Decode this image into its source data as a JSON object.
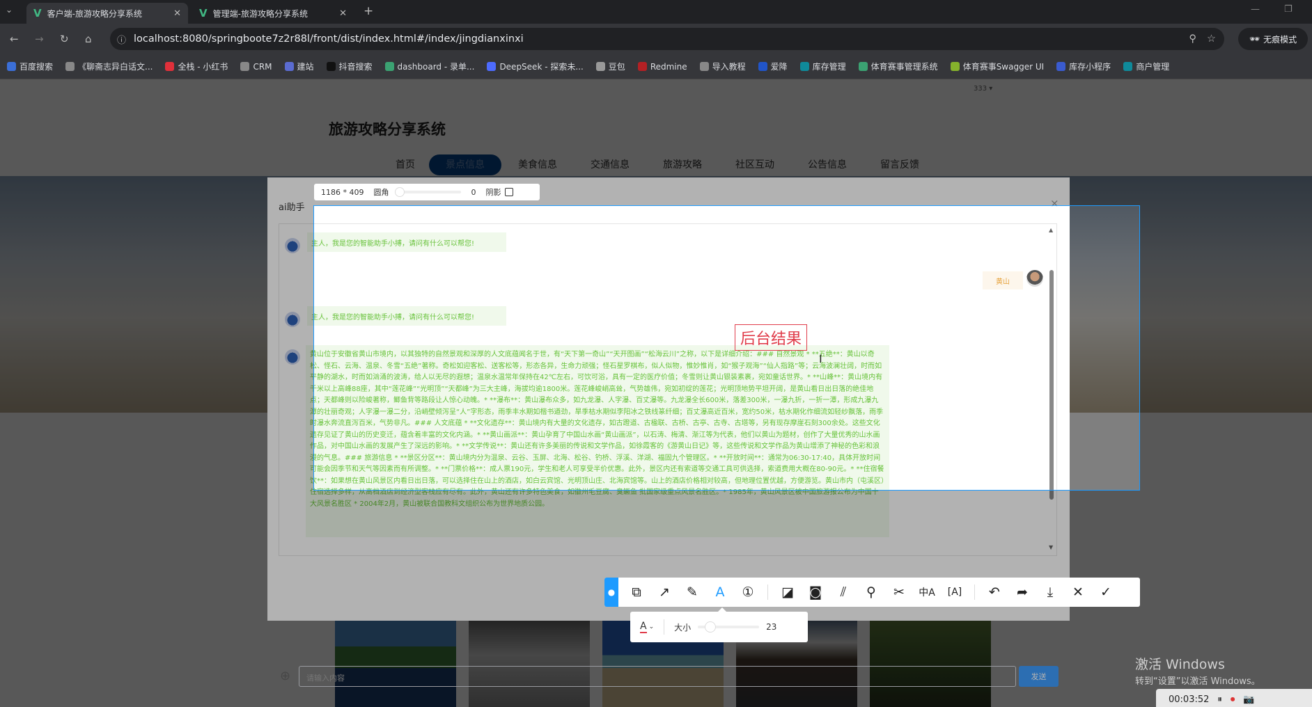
{
  "browser": {
    "tabs": [
      {
        "title": "客户端-旅游攻略分享系统",
        "active": true
      },
      {
        "title": "管理端-旅游攻略分享系统",
        "active": false
      }
    ],
    "url": "localhost:8080/springboote7z2r88l/front/dist/index.html#/index/jingdianxinxi",
    "incognito_label": "无痕模式",
    "bookmarks": [
      {
        "label": "百度搜索",
        "color": "#3b6fd8"
      },
      {
        "label": "《聊斋志异白话文...",
        "color": "#888"
      },
      {
        "label": "全栈 - 小红书",
        "color": "#e0303a"
      },
      {
        "label": "CRM",
        "color": "#888"
      },
      {
        "label": "建站",
        "color": "#5a6bd0"
      },
      {
        "label": "抖音搜索",
        "color": "#111"
      },
      {
        "label": "dashboard - 录单...",
        "color": "#3ba272"
      },
      {
        "label": "DeepSeek - 探索未...",
        "color": "#4d6bfe"
      },
      {
        "label": "豆包",
        "color": "#999"
      },
      {
        "label": "Redmine",
        "color": "#b32024"
      },
      {
        "label": "导入教程",
        "color": "#888"
      },
      {
        "label": "爱降",
        "color": "#2155c9"
      },
      {
        "label": "库存管理",
        "color": "#0f8a9a"
      },
      {
        "label": "体育赛事管理系统",
        "color": "#3ba272"
      },
      {
        "label": "体育赛事Swagger UI",
        "color": "#85b22c"
      },
      {
        "label": "库存小程序",
        "color": "#3a5bd0"
      },
      {
        "label": "商户管理",
        "color": "#0f8a9a"
      }
    ]
  },
  "site": {
    "dropdown": "333 ▾",
    "title": "旅游攻略分享系统",
    "nav": [
      "首页",
      "景点信息",
      "美食信息",
      "交通信息",
      "旅游攻略",
      "社区互动",
      "公告信息",
      "留言反馈"
    ],
    "active_nav": 1
  },
  "dialog": {
    "title": "ai助手",
    "close": "×",
    "messages": [
      {
        "role": "bot",
        "text": "主人，我是您的智能助手小搏，请问有什么可以帮您!"
      },
      {
        "role": "user",
        "text": "黄山"
      },
      {
        "role": "bot",
        "text": "主人，我是您的智能助手小搏，请问有什么可以帮您!"
      },
      {
        "role": "bot",
        "text": "黄山位于安徽省黄山市境内，以其独特的自然景观和深厚的人文底蕴闻名于世，有“天下第一奇山”“天开图画”“松海云川”之称，以下是详细介绍：### 自然景观 * **五绝**：黄山以奇松、怪石、云海、温泉、冬雪“五绝”著称。奇松如迎客松、送客松等，形态各异，生命力顽强；怪石星罗棋布，似人似物，惟妙惟肖，如“猴子观海”“仙人指路”等；云海波澜壮阔，时而如平静的湖水，时而如汹涌的波涛，给人以无尽的遐想；温泉水温常年保持在42℃左右，可饮可浴，具有一定的医疗价值；冬雪则让黄山银装素裹，宛如童话世界。* **山峰**：黄山境内有千米以上高峰88座，其中“莲花峰”“光明顶”“天都峰”为三大主峰，海拔均逾1800米。莲花峰峻峭高耸，气势雄伟，宛如初绽的莲花；光明顶地势平坦开阔，是黄山看日出日落的绝佳地点；天都峰则以险峻著称，鲫鱼背等路段让人惊心动魄。* **瀑布**：黄山瀑布众多，如九龙瀑、人字瀑、百丈瀑等。九龙瀑全长600米，落差300米，一瀑九折，一折一潭，形成九瀑九潭的壮丽奇观；人字瀑一瀑二分，沿峭壁倾泻呈“人”字形态，雨季丰水期如楷书遒劲，旱季枯水期似李阳冰之铁线篆纤细；百丈瀑高近百米，宽约50米，枯水期化作细流如轻纱飘落，雨季时瀑水奔流直泻百米，气势非凡。### 人文底蕴 * **文化遗存**：黄山境内有大量的文化遗存，如古蹬道、古楹联、古桥、古亭、古寺、古塔等，另有现存摩崖石刻300余处。这些文化遗存见证了黄山的历史变迁，蕴含着丰富的文化内涵。* **黄山画派**：黄山孕育了中国山水画“黄山画派”，以石涛、梅清、渐江等为代表，他们以黄山为题材，创作了大量优秀的山水画作品，对中国山水画的发展产生了深远的影响。* **文学传说**：黄山还有许多美丽的传说和文学作品，如徐霞客的《游黄山日记》等，这些传说和文学作品为黄山增添了神秘的色彩和浪漫的气息。### 旅游信息 * **景区分区**：黄山境内分为温泉、云谷、玉屏、北海、松谷、钓桥、浮溪、洋湖、福固九个管理区。* **开放时间**：通常为06:30-17:40，具体开放时间可能会因季节和天气等因素而有所调整。* **门票价格**：成人票190元，学生和老人可享受半价优惠。此外，景区内还有索道等交通工具可供选择，索道费用大概在80-90元。* **住宿餐饮**：如果想在黄山风景区内看日出日落，可以选择住在山上的酒店，如白云宾馆、光明顶山庄、北海宾馆等。山上的酒店价格相对较高，但地理位置优越，方便游览。黄山市内（屯溪区）住宿选择多样，从高档酒店到经济型客栈应有尽有。此外，黄山还有许多特色美食，如徽州毛豆腐、臭鳜鱼 批国家级重点风景名胜区。* 1985年，黄山风景区被中国旅游报公布为中国十大风景名胜区 * 2004年2月，黄山被联合国教科文组织公布为世界地质公园。"
      }
    ],
    "input_placeholder": "请输入内容",
    "send_label": "发送"
  },
  "screenshot_tool": {
    "size": "1186 * 409",
    "radius_label": "圆角",
    "radius_value": "0",
    "shadow_label": "阴影",
    "shadow_checked": false,
    "annotation_text": "后台结果",
    "annotation_color": "#e03c4a",
    "tools": [
      "pin-icon",
      "shape-icon",
      "arrow-icon",
      "pen-icon",
      "text-icon",
      "number-icon",
      "mosaic-icon",
      "blur-icon",
      "hatch-icon",
      "pin-top-icon",
      "scissors-icon",
      "translate-icon",
      "ocr-icon",
      "undo-icon",
      "redo-icon",
      "download-icon",
      "close-icon",
      "confirm-icon"
    ],
    "active_tool": "text-icon",
    "text_color": "#e03c4a",
    "size_label": "大小",
    "size_value": "23",
    "size_fraction": 0.2
  },
  "windows": {
    "activate_title": "激活 Windows",
    "activate_sub": "转到“设置”以激活 Windows。"
  },
  "recorder": {
    "time": "00:03:52"
  }
}
